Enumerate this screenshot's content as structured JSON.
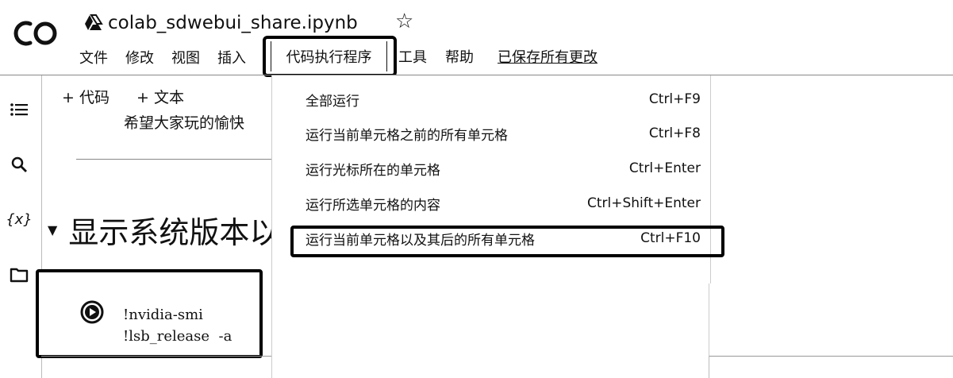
{
  "header": {
    "notebook_title": "colab_sdwebui_share.ipynb",
    "star_icon": "star-outline-icon"
  },
  "menubar": {
    "items": [
      "文件",
      "修改",
      "视图",
      "插入"
    ],
    "active": "代码执行程序",
    "tools": "工具",
    "help": "帮助",
    "saved_status": "已保存所有更改"
  },
  "toolbar": {
    "add_code": "+ 代码",
    "add_text": "+ 文本"
  },
  "notebook": {
    "text_cell": "希望大家玩的愉快",
    "heading": "显示系统版本以",
    "code_lines": "!nvidia-smi\n!lsb_release  -a"
  },
  "dropdown": {
    "items": [
      {
        "label": "全部运行",
        "shortcut": "Ctrl+F9"
      },
      {
        "label": "运行当前单元格之前的所有单元格",
        "shortcut": "Ctrl+F8"
      },
      {
        "label": "运行光标所在的单元格",
        "shortcut": "Ctrl+Enter"
      },
      {
        "label": "运行所选单元格的内容",
        "shortcut": "Ctrl+Shift+Enter"
      },
      {
        "label": "运行当前单元格以及其后的所有单元格",
        "shortcut": "Ctrl+F10"
      }
    ]
  },
  "sidebar": {
    "icons": [
      "toc-icon",
      "search-icon",
      "variables-icon",
      "folder-icon"
    ],
    "variables_label": "{x}"
  }
}
